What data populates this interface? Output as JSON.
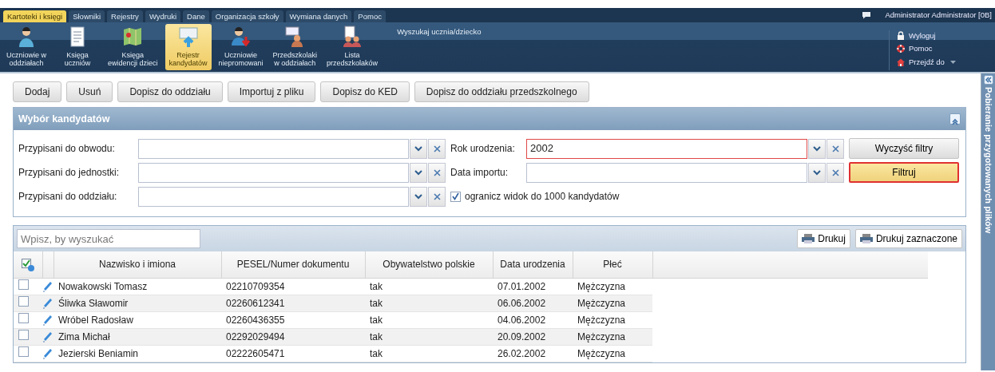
{
  "menu_tabs": [
    {
      "label": "Kartoteki i księgi",
      "selected": true
    },
    {
      "label": "Słowniki",
      "selected": false
    },
    {
      "label": "Rejestry",
      "selected": false
    },
    {
      "label": "Wydruki",
      "selected": false
    },
    {
      "label": "Dane",
      "selected": false
    },
    {
      "label": "Organizacja szkoły",
      "selected": false
    },
    {
      "label": "Wymiana danych",
      "selected": false
    },
    {
      "label": "Pomoc",
      "selected": false
    }
  ],
  "user": "Administrator Administrator [0B]",
  "ribbon_items": [
    {
      "kind": "person",
      "label": "Uczniowie w\noddziałach",
      "selected": false
    },
    {
      "kind": "document",
      "label": "Księga\nuczniów",
      "selected": false
    },
    {
      "kind": "map",
      "label": "Księga\newidencji dzieci",
      "selected": false
    },
    {
      "kind": "board",
      "label": "Rejestr\nkandydatów",
      "selected": true
    },
    {
      "kind": "person-down",
      "label": "Uczniowie\nniepromowani",
      "selected": false
    },
    {
      "kind": "group-board",
      "label": "Przedszkolaki\nw oddziałach",
      "selected": false
    },
    {
      "kind": "group-list",
      "label": "Lista\nprzedszkolaków",
      "selected": false
    }
  ],
  "search_label": "Wyszukaj ucznia/dziecko",
  "user_menu": [
    {
      "kind": "lock",
      "label": "Wyloguj",
      "dropdown": false
    },
    {
      "kind": "lifebuoy",
      "label": "Pomoc",
      "dropdown": false
    },
    {
      "kind": "home",
      "label": "Przejdź do",
      "dropdown": true
    }
  ],
  "toolbar": [
    "Dodaj",
    "Usuń",
    "Dopisz do oddziału",
    "Importuj z pliku",
    "Dopisz do KED",
    "Dopisz do oddziału przedszkolnego"
  ],
  "filter_panel": {
    "title": "Wybór kandydatów",
    "left_fields": [
      {
        "label": "Przypisani do obwodu:"
      },
      {
        "label": "Przypisani do jednostki:"
      },
      {
        "label": "Przypisani do oddziału:"
      }
    ],
    "right_fields": [
      {
        "label": "Rok urodzenia:",
        "value": "2002",
        "highlighted": true
      },
      {
        "label": "Data importu:",
        "highlighted": false
      }
    ],
    "limit_checkbox": {
      "label": "ogranicz widok do 1000 kandydatów",
      "checked": true
    },
    "buttons": [
      {
        "label": "Wyczyść filtry",
        "highlighted": false
      },
      {
        "label": "Filtruj",
        "highlighted": true
      }
    ]
  },
  "grid": {
    "search_placeholder": "Wpisz, by wyszukać",
    "print_buttons": [
      "Drukuj",
      "Drukuj zaznaczone"
    ],
    "columns": [
      "Nazwisko i imiona",
      "PESEL/Numer dokumentu",
      "Obywatelstwo polskie",
      "Data urodzenia",
      "Płeć"
    ],
    "rows": [
      {
        "checked": false,
        "cells": [
          "Nowakowski Tomasz",
          "02210709354",
          "tak",
          "07.01.2002",
          "Mężczyzna"
        ]
      },
      {
        "checked": false,
        "cells": [
          "Śliwka Sławomir",
          "02260612341",
          "tak",
          "06.06.2002",
          "Mężczyzna"
        ]
      },
      {
        "checked": false,
        "cells": [
          "Wróbel Radosław",
          "02260436355",
          "tak",
          "04.06.2002",
          "Mężczyzna"
        ]
      },
      {
        "checked": false,
        "cells": [
          "Zima Michał",
          "02292029494",
          "tak",
          "20.09.2002",
          "Mężczyzna"
        ]
      },
      {
        "checked": false,
        "cells": [
          "Jezierski Beniamin",
          "02222605471",
          "tak",
          "26.02.2002",
          "Mężczyzna"
        ]
      }
    ]
  },
  "side_panel": {
    "title": "Pobieranie przygotowanych plików"
  }
}
